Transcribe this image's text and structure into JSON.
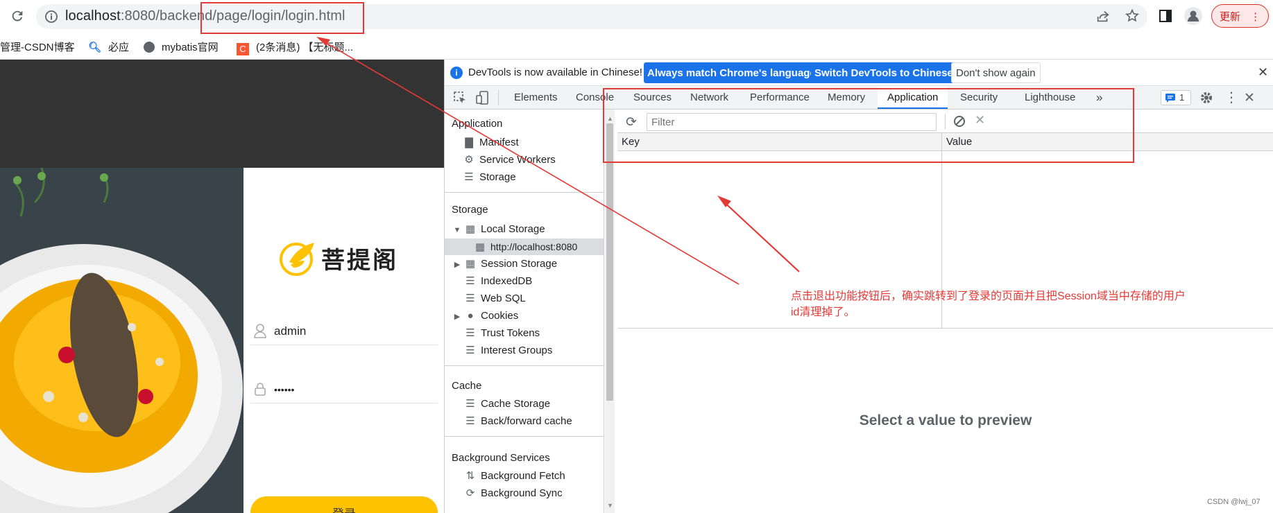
{
  "browser": {
    "url_host": "localhost",
    "url_rest": ":8080/backend/page/login/login.html",
    "update_label": "更新",
    "bookmarks": [
      "管理-CSDN博客",
      "必应",
      "mybatis官网",
      "(2条消息) 【无标题..."
    ]
  },
  "login": {
    "brand": "菩提阁",
    "username": "admin",
    "password": "••••••",
    "submit_label": "登录"
  },
  "devtools": {
    "info_text": "DevTools is now available in Chinese!",
    "match_btn": "Always match Chrome's language",
    "switch_btn": "Switch DevTools to Chinese",
    "dont_show_btn": "Don't show again",
    "tabs": [
      "Elements",
      "Console",
      "Sources",
      "Network",
      "Performance",
      "Memory",
      "Application",
      "Security",
      "Lighthouse"
    ],
    "active_tab": "Application",
    "issues_count": "1",
    "sidebar": {
      "application_title": "Application",
      "application_items": [
        "Manifest",
        "Service Workers",
        "Storage"
      ],
      "storage_title": "Storage",
      "local_storage": "Local Storage",
      "local_origin": "http://localhost:8080",
      "storage_items": [
        "Session Storage",
        "IndexedDB",
        "Web SQL",
        "Cookies",
        "Trust Tokens",
        "Interest Groups"
      ],
      "cache_title": "Cache",
      "cache_items": [
        "Cache Storage",
        "Back/forward cache"
      ],
      "bg_title": "Background Services",
      "bg_items": [
        "Background Fetch",
        "Background Sync"
      ]
    },
    "filter_placeholder": "Filter",
    "columns": [
      "Key",
      "Value"
    ],
    "preview_text": "Select a value to preview"
  },
  "annotation": {
    "note": "点击退出功能按钮后，确实跳转到了登录的页面并且把Session域当中存储的用户id清理掉了。",
    "color": "#e53935"
  },
  "watermark": "CSDN @lwj_07",
  "colors": {
    "accent": "#1a73e8",
    "login_button": "#ffc200",
    "annotation_red": "#e53935"
  }
}
